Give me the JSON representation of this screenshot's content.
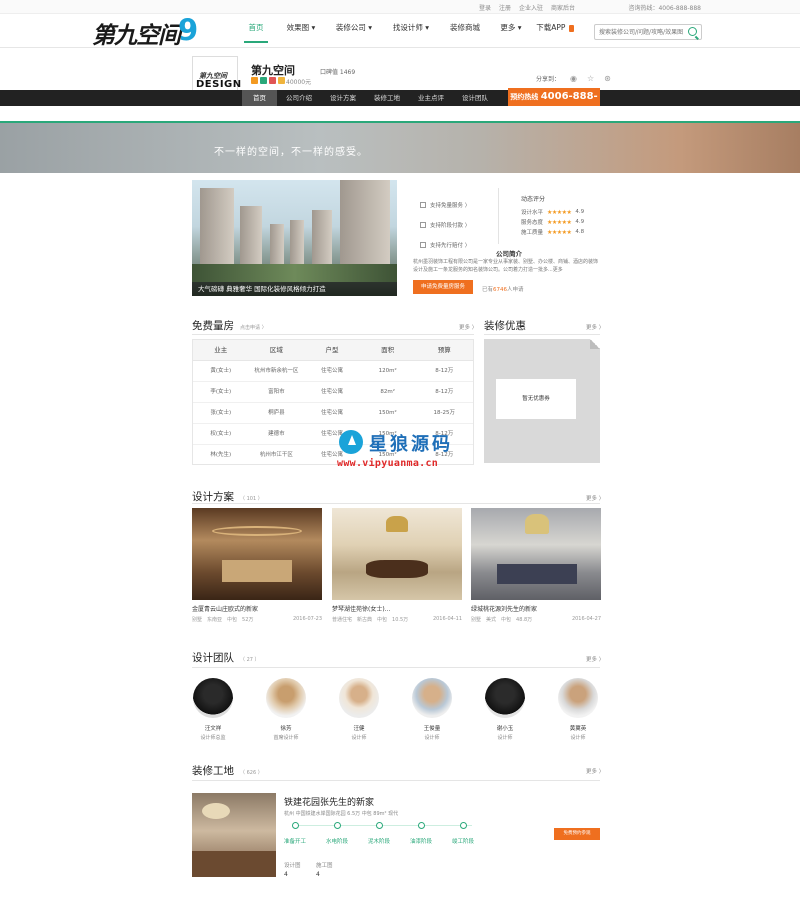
{
  "topbar": {
    "links": [
      "登录",
      "注册",
      "企业入驻",
      "商家后台"
    ],
    "phone": "咨询热线：4006-888-888"
  },
  "logo": {
    "text": "第九空间",
    "nine": "9"
  },
  "nav": [
    {
      "label": "首页",
      "active": true
    },
    {
      "label": "效果图 ▾"
    },
    {
      "label": "装修公司 ▾"
    },
    {
      "label": "找设计师 ▾"
    },
    {
      "label": "装修商城"
    },
    {
      "label": "更多 ▾"
    },
    {
      "label": "下载APP"
    }
  ],
  "search": {
    "placeholder": "搜索装修公司/问题/攻略/效果图"
  },
  "company": {
    "box_l1": "第九空间",
    "box_l2": "DESIGN",
    "box_l3": "中国·杭州",
    "name": "第九空间",
    "money": "40000元",
    "reputation": "口碑值 1469",
    "share_label": "分享到："
  },
  "company_nav": [
    "首页",
    "公司介绍",
    "设计方案",
    "装修工地",
    "业主点评",
    "设计团队"
  ],
  "hotline": {
    "label": "预约热线",
    "number": "4006-888-888"
  },
  "banner": {
    "slogan": "不一样的空间，不一样的感受。"
  },
  "showcase": {
    "caption": "大气磅礴  典雅奢华  国际化装修风格倾力打造"
  },
  "services": [
    "支持免量服务 〉",
    "支持阶段付款 〉",
    "支持先行赔付 〉"
  ],
  "ratings": {
    "title": "动态评分",
    "items": [
      {
        "label": "设计水平",
        "score": "4.9"
      },
      {
        "label": "服务态度",
        "score": "4.9"
      },
      {
        "label": "施工质量",
        "score": "4.8"
      }
    ]
  },
  "intro": {
    "title": "公司简介",
    "text": "杭州墨羽装饰工程有限公司是一家专业从事家装、别墅、办公楼、商铺、酒店的装饰设计及施工一条龙服务的知名装饰公司。公司着力打造一批多...更多"
  },
  "apply": {
    "button": "申请免费量房服务",
    "count_pre": "已有",
    "count": "6746",
    "count_post": "人申请"
  },
  "free_measure": {
    "title": "免费量房",
    "sub": "点击申请 〉",
    "more": "更多 〉",
    "headers": [
      "业主",
      "区域",
      "户型",
      "面积",
      "预算"
    ],
    "rows": [
      [
        "黄(女士)",
        "杭州市新余杭一区",
        "住宅公寓",
        "120m²",
        "8-12万"
      ],
      [
        "李(女士)",
        "富阳市",
        "住宅公寓",
        "82m²",
        "8-12万"
      ],
      [
        "张(女士)",
        "桐庐县",
        "住宅公寓",
        "150m²",
        "18-25万"
      ],
      [
        "权(女士)",
        "建德市",
        "住宅公寓",
        "150m²",
        "8-12万"
      ],
      [
        "林(先生)",
        "杭州市江干区",
        "住宅公寓",
        "150m²",
        "8-12万"
      ]
    ]
  },
  "deals": {
    "title": "装修优惠",
    "more": "更多 〉",
    "empty": "暂无优惠券"
  },
  "designs": {
    "title": "设计方案",
    "count": "（ 101 ）",
    "more": "更多 〉",
    "items": [
      {
        "title": "金厦青云山庄欧式的新家",
        "type": "别墅",
        "district": "东南亚",
        "budget": "中包",
        "price": "52万",
        "date": "2016-07-23"
      },
      {
        "title": "梦琴湖佳苑徐(女士)...",
        "type": "普通住宅",
        "district": "新古典",
        "budget": "中包",
        "price": "10.5万",
        "date": "2016-04-11"
      },
      {
        "title": "绿城桃花源刘先生的新家",
        "type": "别墅",
        "district": "美式",
        "budget": "中包",
        "price": "48.8万",
        "date": "2016-04-27"
      }
    ]
  },
  "team": {
    "title": "设计团队",
    "count": "（ 27 ）",
    "more": "更多 〉",
    "members": [
      {
        "name": "汪文祥",
        "role": "设计师总监"
      },
      {
        "name": "徐芳",
        "role": "首席设计师"
      },
      {
        "name": "汪健",
        "role": "设计师"
      },
      {
        "name": "王俊量",
        "role": "设计师"
      },
      {
        "name": "谢小玉",
        "role": "设计师"
      },
      {
        "name": "黄翼英",
        "role": "设计师"
      }
    ]
  },
  "worksite": {
    "title": "装修工地",
    "count": "（ 626 ）",
    "more": "更多 〉",
    "item": {
      "title": "铁建花园张先生的新家",
      "meta": "杭州   中国铁建水岸国际花园   6.5万   中包   89m²   现代",
      "stages": [
        "准备开工",
        "水电阶段",
        "泥木阶段",
        "油漆阶段",
        "竣工阶段"
      ],
      "designers_label": "设计图",
      "designers_value": "4",
      "workers_label": "施工图",
      "workers_value": "4",
      "button": "免费预约参观"
    }
  },
  "watermark": {
    "text": "星狼源码",
    "url": "www.vipyuanma.cn"
  },
  "colors": {
    "accent": "#2aa87a",
    "orange": "#ef6f1f",
    "dark": "#222222",
    "star": "#f39a22"
  }
}
